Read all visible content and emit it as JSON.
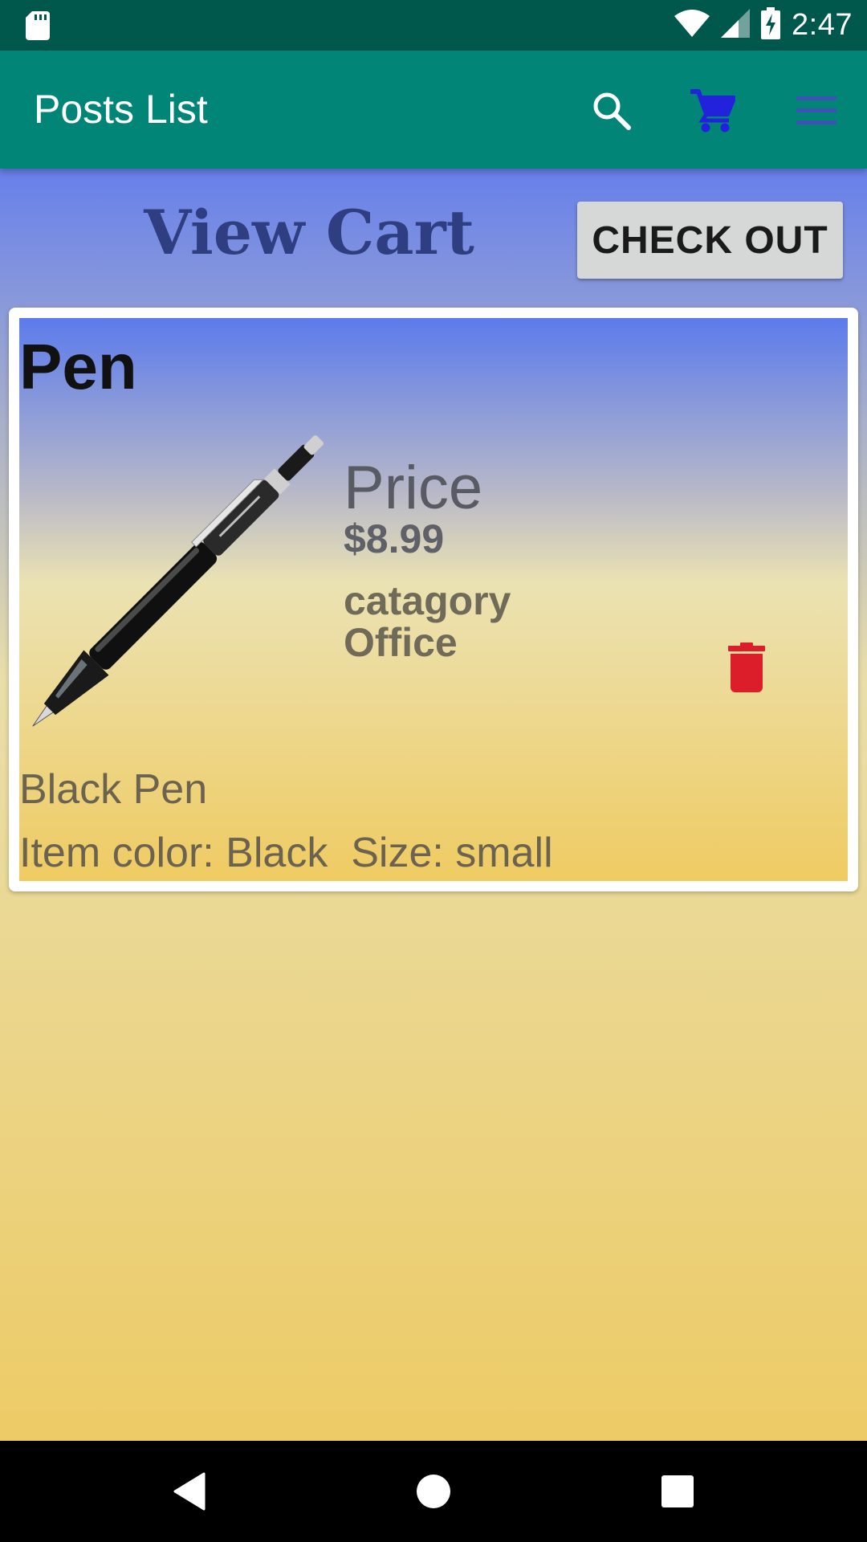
{
  "status_bar": {
    "time": "2:47",
    "icons": [
      "sd-card-icon",
      "wifi-icon",
      "signal-icon",
      "battery-charging-icon"
    ]
  },
  "app_bar": {
    "title": "Posts List",
    "actions": [
      "search-icon",
      "cart-icon",
      "menu-icon"
    ]
  },
  "page": {
    "heading": "View Cart",
    "checkout_label": "CHECK OUT"
  },
  "cart": {
    "items": [
      {
        "name": "Pen",
        "image": "pen-image",
        "price_label": "Price",
        "price": "$8.99",
        "category_label": "catagory",
        "category": "Office",
        "description": "Black Pen",
        "attributes": "Item color: Black  Size: small",
        "delete_icon": "trash-icon"
      }
    ]
  },
  "nav_bar": {
    "buttons": [
      "back-icon",
      "home-icon",
      "recents-icon"
    ]
  },
  "colors": {
    "status_bar": "#00574B",
    "app_bar": "#008577",
    "cart_icon": "#2222DD",
    "menu_icon": "#3F51B5",
    "heading": "#2E3E80",
    "delete_icon": "#DC1E2A",
    "gradient_top": "#6780EB",
    "gradient_bottom": "#EDCB66"
  }
}
